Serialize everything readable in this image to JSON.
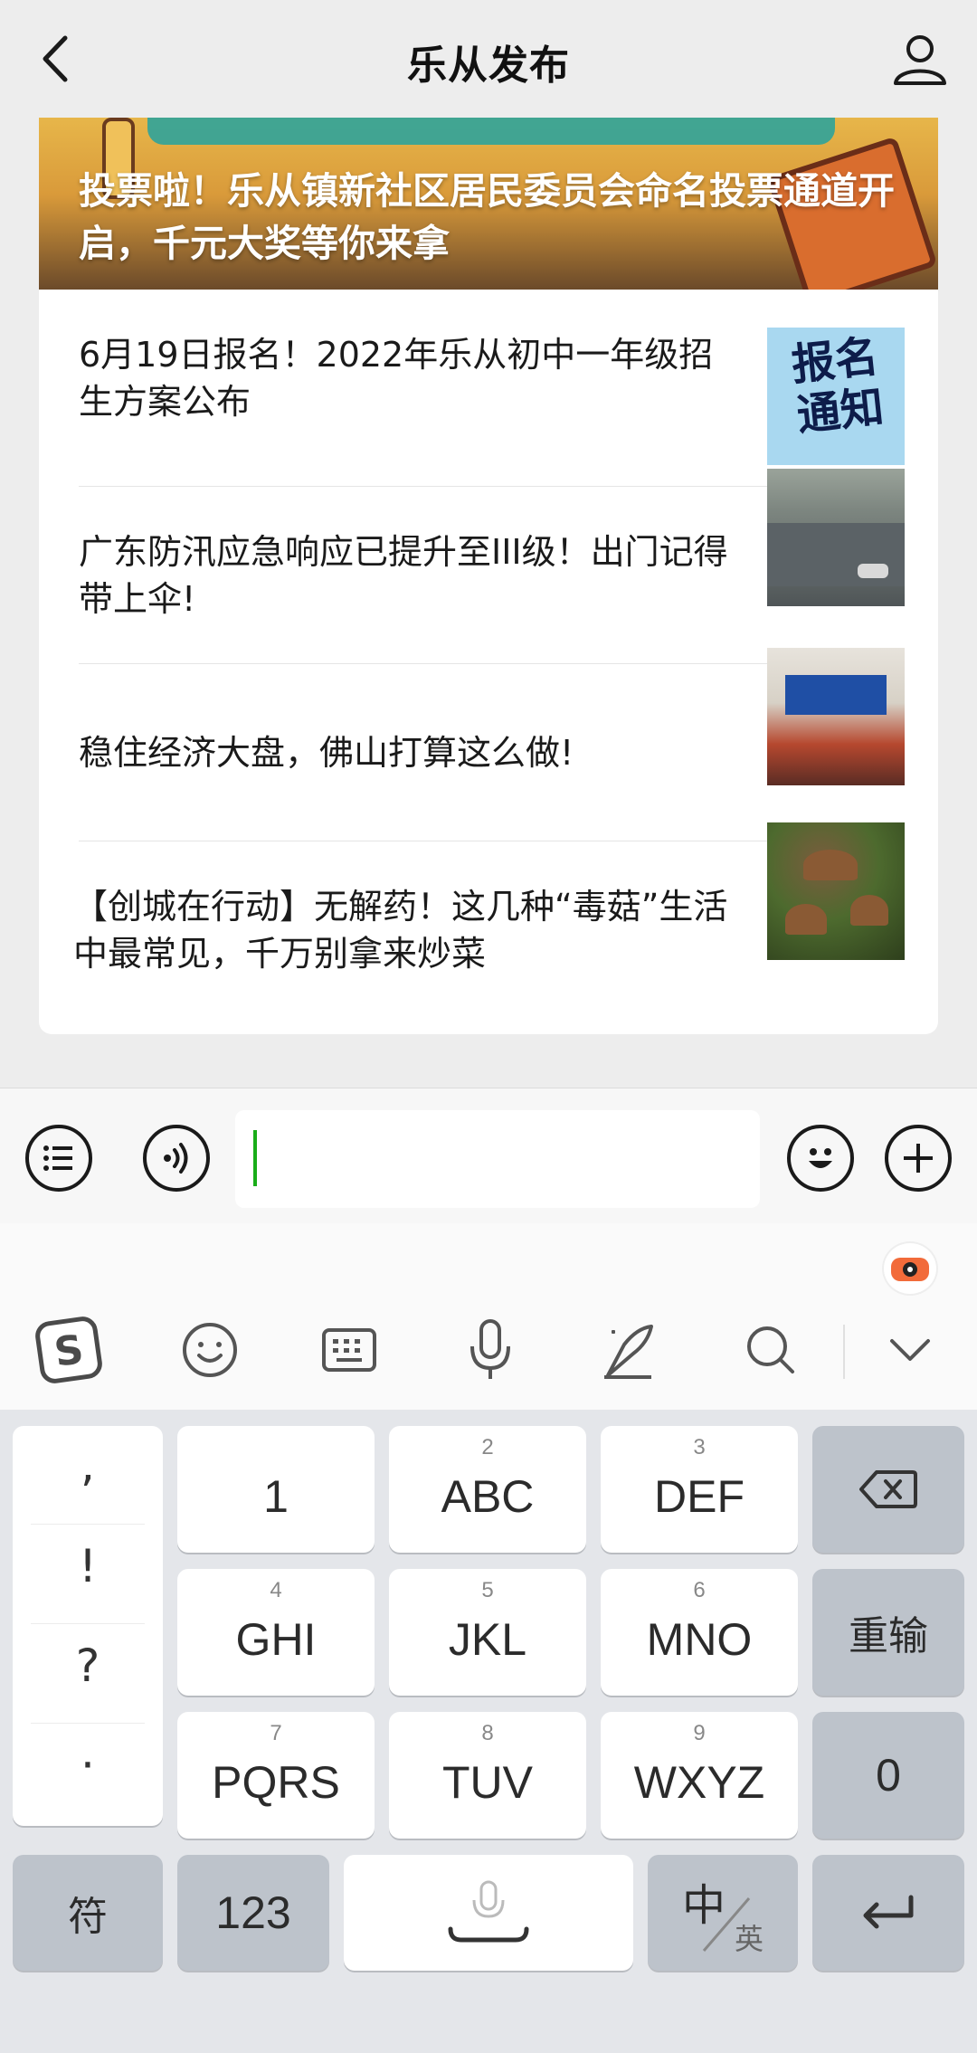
{
  "header": {
    "title": "乐从发布",
    "back_icon": "chevron-left-icon",
    "profile_icon": "person-icon"
  },
  "feed": {
    "banner_title": "投票啦！乐从镇新社区居民委员会命名投票通道开启，千元大奖等你来拿",
    "articles": [
      {
        "title": "6月19日报名！2022年乐从初中一年级招生方案公布",
        "thumb_text": "报名通知"
      },
      {
        "title": "广东防汛应急响应已提升至III级！出门记得带上伞!"
      },
      {
        "title": "稳住经济大盘，佛山打算这么做!"
      },
      {
        "title": "【创城在行动】无解药！这几种“毒菇”生活中最常见，千万别拿来炒菜"
      }
    ]
  },
  "input_bar": {
    "placeholder": "",
    "accent": "#1aad19"
  },
  "keyboard": {
    "punct": [
      ",",
      "!",
      "?",
      "·"
    ],
    "rows": [
      [
        {
          "sup": "",
          "label": "1"
        },
        {
          "sup": "2",
          "label": "ABC"
        },
        {
          "sup": "3",
          "label": "DEF"
        }
      ],
      [
        {
          "sup": "4",
          "label": "GHI"
        },
        {
          "sup": "5",
          "label": "JKL"
        },
        {
          "sup": "6",
          "label": "MNO"
        }
      ],
      [
        {
          "sup": "7",
          "label": "PQRS"
        },
        {
          "sup": "8",
          "label": "TUV"
        },
        {
          "sup": "9",
          "label": "WXYZ"
        }
      ]
    ],
    "reinput": "重输",
    "zero": "0",
    "symbols": "符",
    "num": "123",
    "lang_main": "中",
    "lang_sub": "英"
  }
}
